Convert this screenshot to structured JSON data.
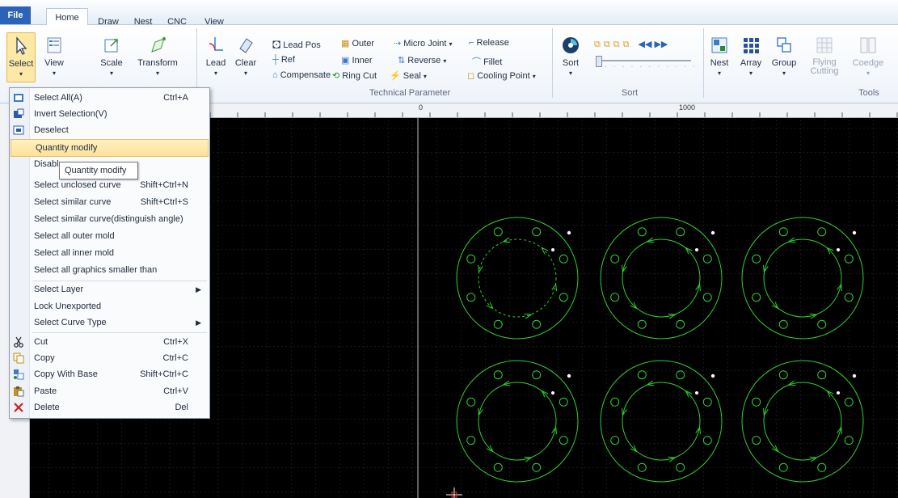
{
  "tabs": [
    "File",
    "Home",
    "Draw",
    "Nest",
    "CNC",
    "View"
  ],
  "ribbon": {
    "select": "Select",
    "view": "View",
    "scale": "Scale",
    "transform": "Transform",
    "lead": "Lead",
    "clear": "Clear",
    "lead_pos": "Lead Pos",
    "ref": "Ref",
    "compensate": "Compensate",
    "outer": "Outer",
    "inner": "Inner",
    "ring_cut": "Ring Cut",
    "micro_joint": "Micro Joint",
    "reverse": "Reverse",
    "seal": "Seal",
    "release": "Release",
    "fillet": "Fillet",
    "cooling_point": "Cooling Point",
    "technical_parameter": "Technical Parameter",
    "sort": "Sort",
    "sort_group": "Sort",
    "nest": "Nest",
    "array": "Array",
    "group": "Group",
    "flying_cutting": "Flying Cutting",
    "coedge": "Coedge",
    "tools": "Tools"
  },
  "rulers": {
    "zero": "0",
    "thousand": "1000"
  },
  "menu": {
    "items": [
      {
        "label": "Select All(A)",
        "shortcut": "Ctrl+A"
      },
      {
        "label": "Invert Selection(V)",
        "shortcut": ""
      },
      {
        "label": "Deselect",
        "shortcut": ""
      },
      {
        "label": "Quantity modify",
        "shortcut": ""
      },
      {
        "label": "Disable",
        "shortcut": ""
      },
      {
        "label": "Select unclosed curve",
        "shortcut": "Shift+Ctrl+N"
      },
      {
        "label": "Select similar curve",
        "shortcut": "Shift+Ctrl+S"
      },
      {
        "label": "Select similar curve(distinguish angle)",
        "shortcut": ""
      },
      {
        "label": "Select all outer mold",
        "shortcut": ""
      },
      {
        "label": "Select all inner mold",
        "shortcut": ""
      },
      {
        "label": "Select all graphics smaller than",
        "shortcut": ""
      },
      {
        "label": "Select Layer",
        "shortcut": ""
      },
      {
        "label": "Lock Unexported",
        "shortcut": ""
      },
      {
        "label": "Select Curve Type",
        "shortcut": ""
      },
      {
        "label": "Cut",
        "shortcut": "Ctrl+X"
      },
      {
        "label": "Copy",
        "shortcut": "Ctrl+C"
      },
      {
        "label": "Copy With Base",
        "shortcut": "Shift+Ctrl+C"
      },
      {
        "label": "Paste",
        "shortcut": "Ctrl+V"
      },
      {
        "label": "Delete",
        "shortcut": "Del"
      }
    ],
    "tooltip": "Quantity modify"
  },
  "colors": {
    "accent": "#2a63b8",
    "canvas_bg": "#000000",
    "part_stroke": "#2fd12f",
    "highlight": "#fde19a"
  }
}
